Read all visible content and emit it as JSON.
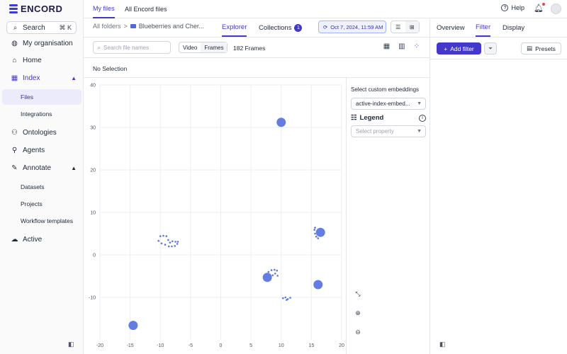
{
  "brand": {
    "name": "ENCORD",
    "accent": "#4338ca"
  },
  "sidebar": {
    "search_label": "Search",
    "search_shortcut": "⌘ K",
    "items": [
      {
        "label": "My organisation",
        "icon": "globe-icon"
      },
      {
        "label": "Home",
        "icon": "home-icon"
      },
      {
        "label": "Index",
        "icon": "index-icon",
        "expanded": true
      },
      {
        "label": "Ontologies",
        "icon": "ontology-icon"
      },
      {
        "label": "Agents",
        "icon": "agents-icon"
      },
      {
        "label": "Annotate",
        "icon": "annotate-icon",
        "expanded": true
      },
      {
        "label": "Active",
        "icon": "active-icon"
      }
    ],
    "index_children": [
      "Files",
      "Integrations"
    ],
    "annotate_children": [
      "Datasets",
      "Projects",
      "Workflow templates"
    ],
    "selected_child": "Files"
  },
  "topbar": {
    "tabs": [
      "My files",
      "All Encord files"
    ],
    "active_tab": "My files",
    "help_label": "Help"
  },
  "explorer": {
    "breadcrumb_root": "All folders",
    "breadcrumb_sep": ">",
    "breadcrumb_current": "Blueberries and Cher...",
    "tabs": {
      "explorer": "Explorer",
      "collections": "Collections",
      "collections_count": "1"
    },
    "date_label": "Oct 7, 2024, 11:59 AM",
    "search_placeholder": "Search file names",
    "mode_video": "Video",
    "mode_frames": "Frames",
    "frames_count": "182 Frames",
    "selection_text": "No Selection"
  },
  "embedding_panel": {
    "label": "Select custom embeddings",
    "selected": "active-index-embed...",
    "legend_title": "Legend",
    "property_placeholder": "Select property"
  },
  "right_panel": {
    "tabs": [
      "Overview",
      "Filter",
      "Display"
    ],
    "active_tab": "Filter",
    "add_filter": "Add filter",
    "presets": "Presets"
  },
  "chart_data": {
    "type": "scatter",
    "title": "",
    "xlabel": "",
    "ylabel": "",
    "xlim": [
      -20,
      20
    ],
    "ylim": [
      -20,
      40
    ],
    "xticks": [
      -20,
      -15,
      -10,
      -5,
      0,
      5,
      10,
      15,
      20
    ],
    "yticks": [
      -10,
      0,
      10,
      20,
      30,
      40
    ],
    "grid": true,
    "point_color": "#5b76e0",
    "cluster_points": [
      {
        "x": 10,
        "y": 31.2
      },
      {
        "x": 16.5,
        "y": 5.3
      },
      {
        "x": 7.7,
        "y": -5.3
      },
      {
        "x": 16.1,
        "y": -7
      },
      {
        "x": -14.5,
        "y": -16.6
      }
    ],
    "small_points": [
      {
        "x": -10,
        "y": 4.4
      },
      {
        "x": -9.5,
        "y": 4.5
      },
      {
        "x": -9,
        "y": 4.4
      },
      {
        "x": -10.3,
        "y": 3.3
      },
      {
        "x": -9.8,
        "y": 2.7
      },
      {
        "x": -9.2,
        "y": 2.4
      },
      {
        "x": -8.6,
        "y": 2
      },
      {
        "x": -8.1,
        "y": 2
      },
      {
        "x": -7.6,
        "y": 2.1
      },
      {
        "x": -7.2,
        "y": 2.6
      },
      {
        "x": -7.5,
        "y": 3.1
      },
      {
        "x": -8,
        "y": 3.2
      },
      {
        "x": -8.4,
        "y": 2.9
      },
      {
        "x": -8.7,
        "y": 3.5
      },
      {
        "x": -7.1,
        "y": 3.1
      },
      {
        "x": 7.9,
        "y": -4.0
      },
      {
        "x": 8.4,
        "y": -3.6
      },
      {
        "x": 8.9,
        "y": -3.5
      },
      {
        "x": 9.3,
        "y": -3.7
      },
      {
        "x": 9.0,
        "y": -4.4
      },
      {
        "x": 8.6,
        "y": -4.8
      },
      {
        "x": 9.4,
        "y": -4.9
      },
      {
        "x": 10.3,
        "y": -10.2
      },
      {
        "x": 10.7,
        "y": -10.0
      },
      {
        "x": 11.1,
        "y": -10.4
      },
      {
        "x": 11.5,
        "y": -10.1
      },
      {
        "x": 10.9,
        "y": -10.6
      },
      {
        "x": 15.6,
        "y": 6.4
      },
      {
        "x": 15.5,
        "y": 5.9
      },
      {
        "x": 15.6,
        "y": 5.0
      },
      {
        "x": 15.8,
        "y": 4.3
      },
      {
        "x": 16.1,
        "y": 3.9
      },
      {
        "x": -14.7,
        "y": -15.9
      }
    ]
  }
}
